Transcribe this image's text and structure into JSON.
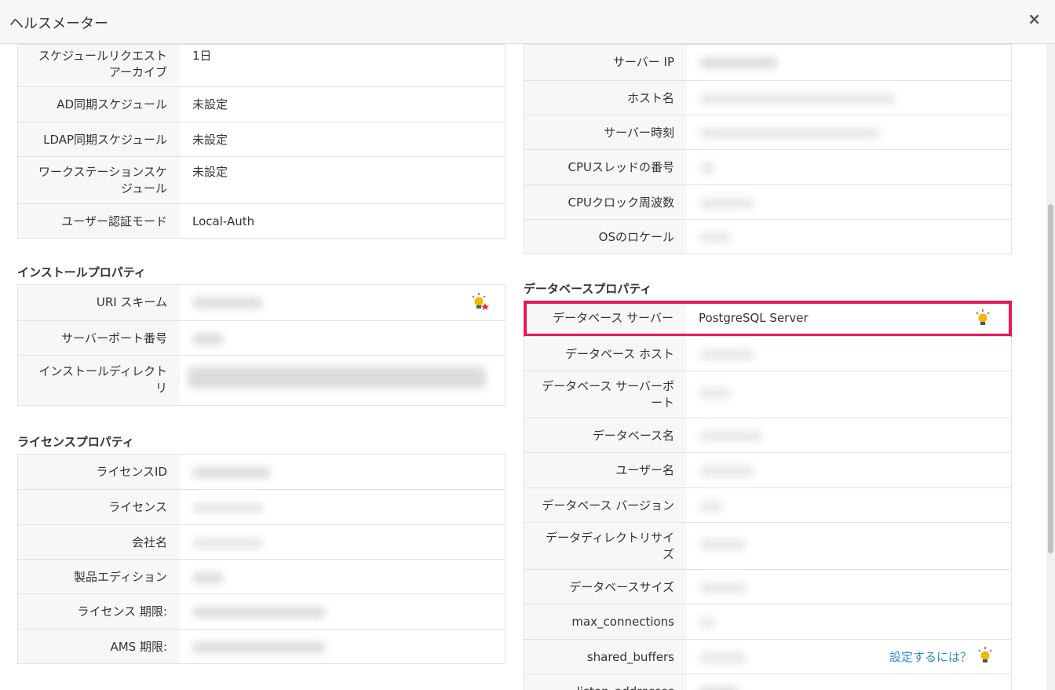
{
  "header": {
    "title": "ヘルスメーター",
    "close_label": "×"
  },
  "left": {
    "general_rows": [
      {
        "label": "スケジュールリクエスト\nアーカイブ",
        "value": "1日"
      },
      {
        "label": "AD同期スケジュール",
        "value": "未設定"
      },
      {
        "label": "LDAP同期スケジュール",
        "value": "未設定"
      },
      {
        "label": "ワークステーションスケ\nジュール",
        "value": "未設定"
      },
      {
        "label": "ユーザー認証モード",
        "value": "Local-Auth"
      }
    ],
    "install_title": "インストールプロパティ",
    "install_rows": [
      {
        "label": "URI スキーム"
      },
      {
        "label": "サーバーポート番号"
      },
      {
        "label": "インストールディレクト\nリ"
      }
    ],
    "license_title": "ライセンスプロパティ",
    "license_rows": [
      {
        "label": "ライセンスID"
      },
      {
        "label": "ライセンス"
      },
      {
        "label": "会社名"
      },
      {
        "label": "製品エディション"
      },
      {
        "label": "ライセンス 期限:"
      },
      {
        "label": "AMS 期限:"
      }
    ]
  },
  "right": {
    "server_rows": [
      {
        "label": "サーバー IP"
      },
      {
        "label": "ホスト名"
      },
      {
        "label": "サーバー時刻"
      },
      {
        "label": "CPUスレッドの番号"
      },
      {
        "label": "CPUクロック周波数"
      },
      {
        "label": "OSのロケール"
      }
    ],
    "db_title": "データベースプロパティ",
    "db_rows": [
      {
        "label": "データベース サーバー",
        "value": "PostgreSQL Server"
      },
      {
        "label": "データベース ホスト"
      },
      {
        "label": "データベース サーバーポ\nート"
      },
      {
        "label": "データベース名"
      },
      {
        "label": "ユーザー名"
      },
      {
        "label": "データベース バージョン"
      },
      {
        "label": "データディレクトリサイ\nズ"
      },
      {
        "label": "データベースサイズ"
      },
      {
        "label": "max_connections"
      },
      {
        "label": "shared_buffers",
        "link": "設定するには？"
      },
      {
        "label": "listen_addresses"
      }
    ]
  },
  "colors": {
    "highlight": "#e8175d",
    "link": "#2a8bd4",
    "bulb": "#f2b705",
    "star": "#e52b2b"
  },
  "icons": [
    "close-icon",
    "lightbulb-icon",
    "lightbulb-star-icon"
  ]
}
